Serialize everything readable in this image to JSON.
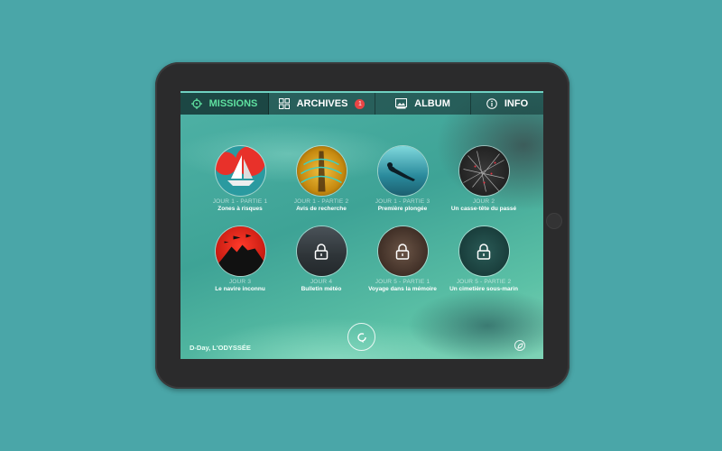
{
  "navbar": {
    "tabs": [
      {
        "label": "MISSIONS",
        "icon": "crosshair-icon",
        "active": true
      },
      {
        "label": "ARCHIVES",
        "icon": "grid-icon",
        "badge": "1"
      },
      {
        "label": "ALBUM",
        "icon": "photo-icon"
      },
      {
        "label": "INFO",
        "icon": "info-icon"
      }
    ]
  },
  "missions": [
    {
      "day": "JOUR 1 - PARTIE 1",
      "title": "Zones à risques",
      "locked": false,
      "art": "sailboat-red"
    },
    {
      "day": "JOUR 1 - PARTIE 2",
      "title": "Avis de recherche",
      "locked": false,
      "art": "radar-gold"
    },
    {
      "day": "JOUR 1 - PARTIE 3",
      "title": "Première plongée",
      "locked": false,
      "art": "diver-blue"
    },
    {
      "day": "JOUR 2",
      "title": "Un casse-tête du passé",
      "locked": false,
      "art": "constellation-dark"
    },
    {
      "day": "JOUR 3",
      "title": "Le navire inconnu",
      "locked": false,
      "art": "soldiers-red"
    },
    {
      "day": "JOUR 4",
      "title": "Bulletin météo",
      "locked": true,
      "art": "storm-grey"
    },
    {
      "day": "JOUR 5 - PARTIE 1",
      "title": "Voyage dans la mémoire",
      "locked": true,
      "art": "compass-brown"
    },
    {
      "day": "JOUR 5 - PARTIE 2",
      "title": "Un cimetière sous-marin",
      "locked": true,
      "art": "wreck-teal"
    }
  ],
  "footer": {
    "app_title": "D-Day, L'ODYSSÉE",
    "refresh_icon": "refresh-icon",
    "badge_icon": "leaf-badge-icon"
  },
  "colors": {
    "background": "#4aa6a8",
    "active_tab": "#5fe0a0",
    "badge": "#e84545"
  }
}
